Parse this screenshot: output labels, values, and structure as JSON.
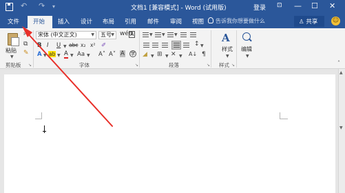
{
  "titlebar": {
    "doc_title": "文档1 [兼容模式] - Word (试用版)",
    "login": "登录",
    "undo_glyph": "↶",
    "redo_glyph": "↷",
    "customize_glyph": "▾",
    "minimize_glyph": "—",
    "maximize_glyph": "☐",
    "close_glyph": "✕",
    "restore_glyph": "⊡"
  },
  "tabs": {
    "file": "文件",
    "home": "开始",
    "insert": "插入",
    "design": "设计",
    "layout": "布局",
    "references": "引用",
    "mailings": "邮件",
    "review": "审阅",
    "view": "视图",
    "tell_me": "告诉我你想要做什么",
    "share": "共享"
  },
  "ribbon": {
    "paste_label": "粘贴",
    "font_name": "宋体 (中文正文)",
    "font_size": "五号",
    "bold": "B",
    "italic": "I",
    "underline": "U",
    "strikethrough": "abc",
    "subscript": "x₂",
    "superscript": "x²",
    "change_case": "Aa",
    "grow_font": "A˄",
    "shrink_font": "A˅",
    "font_color": "A",
    "text_effects": "A",
    "highlight": "ab",
    "styles_label": "样式",
    "editing_label": "编辑",
    "groups": {
      "clipboard": "剪贴板",
      "font": "字体",
      "paragraph": "段落",
      "styles": "样式"
    }
  },
  "colors": {
    "brand": "#2b579a",
    "annotation_arrow": "#e8302a"
  }
}
